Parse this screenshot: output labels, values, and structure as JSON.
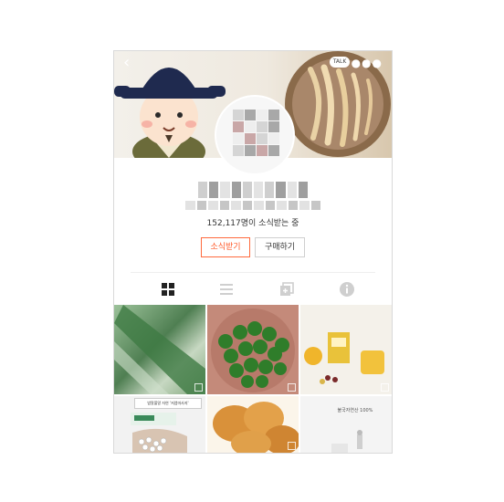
{
  "header": {
    "back_icon": "chevron-left-icon",
    "more_icon": "more-dots-icon",
    "talk_badge": "TALK"
  },
  "profile": {
    "subscribers": "152,117명이 소식받는 중"
  },
  "buttons": {
    "subscribe": "소식받기",
    "purchase": "구매하기"
  },
  "tabs": [
    {
      "name": "grid-view-icon",
      "active": true
    },
    {
      "name": "list-view-icon",
      "active": false
    },
    {
      "name": "multi-post-icon",
      "active": false
    },
    {
      "name": "info-icon",
      "active": false
    }
  ],
  "posts": {
    "post4_banner": "밥알볼알 자연 '저염마사지'",
    "post6_caption": "불국자연산 100%"
  },
  "colors": {
    "accent": "#ff5a2a",
    "tab_active": "#222222",
    "tab_inactive": "#cfcfcf"
  }
}
